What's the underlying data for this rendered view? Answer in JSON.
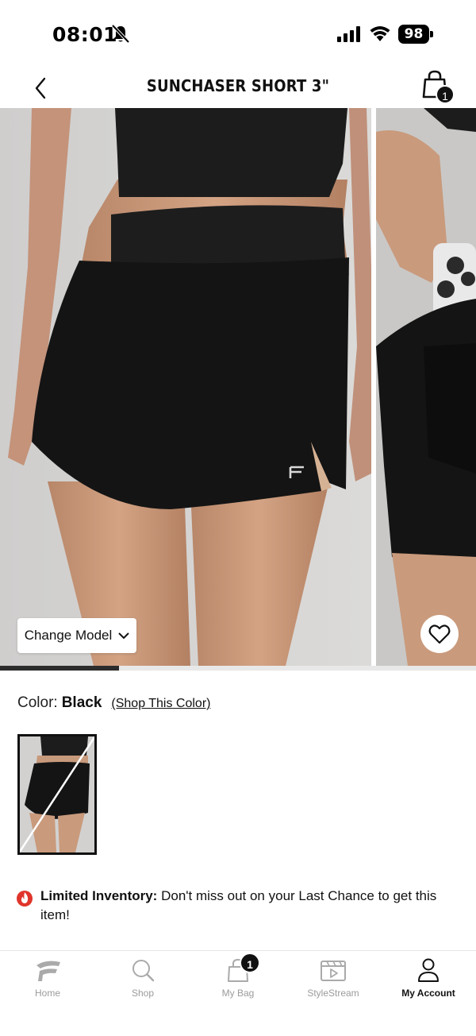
{
  "status_bar": {
    "time": "08:01",
    "battery": "98"
  },
  "header": {
    "title": "SUNCHASER SHORT 3\"",
    "bag_count": "1"
  },
  "gallery": {
    "change_model_label": "Change Model",
    "progress": 0.25
  },
  "color": {
    "label": "Color:",
    "value": "Black",
    "shop_link": "(Shop This Color)"
  },
  "notice": {
    "strong": "Limited Inventory:",
    "text": " Don't miss out on your Last Chance to get this item!"
  },
  "tabs": [
    {
      "label": "Home",
      "icon": "brand-logo-icon",
      "active": false
    },
    {
      "label": "Shop",
      "icon": "search-icon",
      "active": false
    },
    {
      "label": "My Bag",
      "icon": "bag-icon",
      "active": false,
      "badge": "1"
    },
    {
      "label": "StyleStream",
      "icon": "video-icon",
      "active": false
    },
    {
      "label": "My Account",
      "icon": "user-icon",
      "active": true
    }
  ],
  "colors": {
    "accent": "#111111",
    "flame": "#e0352b",
    "inactive": "#9b9b9b"
  }
}
